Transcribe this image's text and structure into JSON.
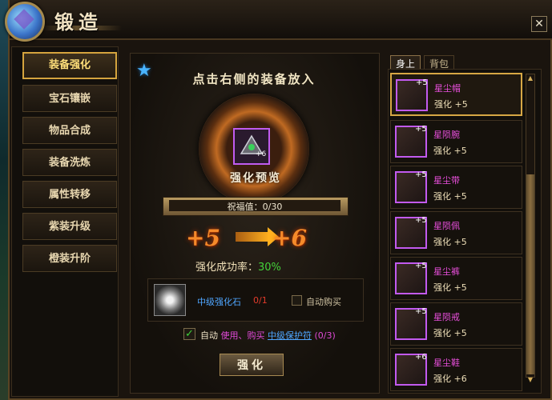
{
  "window": {
    "title": "锻造",
    "close_label": "✕"
  },
  "nav": {
    "items": [
      {
        "label": "装备强化"
      },
      {
        "label": "宝石镶嵌"
      },
      {
        "label": "物品合成"
      },
      {
        "label": "装备洗炼"
      },
      {
        "label": "属性转移"
      },
      {
        "label": "紫装升级"
      },
      {
        "label": "橙装升阶"
      }
    ],
    "active_index": 0
  },
  "forge": {
    "hint": "点击右侧的装备放入",
    "preview_label": "强化预览",
    "slot_plus": "+6",
    "blessing": "祝福值：0/30",
    "level_from": "+5",
    "level_to": "+6",
    "rate_label": "强化成功率：",
    "rate_value": "30%",
    "material_name": "中级强化石",
    "material_count": "0/1",
    "auto_buy_label": "自动购买",
    "auto_label": "自动",
    "auto_use_buy": "使用、购买",
    "auto_protect_link": "中级保护符",
    "auto_protect_count": "(0/3)",
    "strengthen_button": "强化"
  },
  "inventory": {
    "tabs": [
      {
        "label": "身上"
      },
      {
        "label": "背包"
      }
    ],
    "items": [
      {
        "name": "星尘帽",
        "bonus": "强化 +5",
        "plus": "+5"
      },
      {
        "name": "星陨腕",
        "bonus": "强化 +5",
        "plus": "+5"
      },
      {
        "name": "星尘带",
        "bonus": "强化 +5",
        "plus": "+5"
      },
      {
        "name": "星陨佩",
        "bonus": "强化 +5",
        "plus": "+5"
      },
      {
        "name": "星尘裤",
        "bonus": "强化 +5",
        "plus": "+5"
      },
      {
        "name": "星陨戒",
        "bonus": "强化 +5",
        "plus": "+5"
      },
      {
        "name": "星尘鞋",
        "bonus": "强化 +6",
        "plus": "+6"
      }
    ]
  },
  "colors": {
    "accent": "#d7a744",
    "item_name": "#e94fdc",
    "success_rate": "#44d23a",
    "link": "#4fa6ff"
  }
}
